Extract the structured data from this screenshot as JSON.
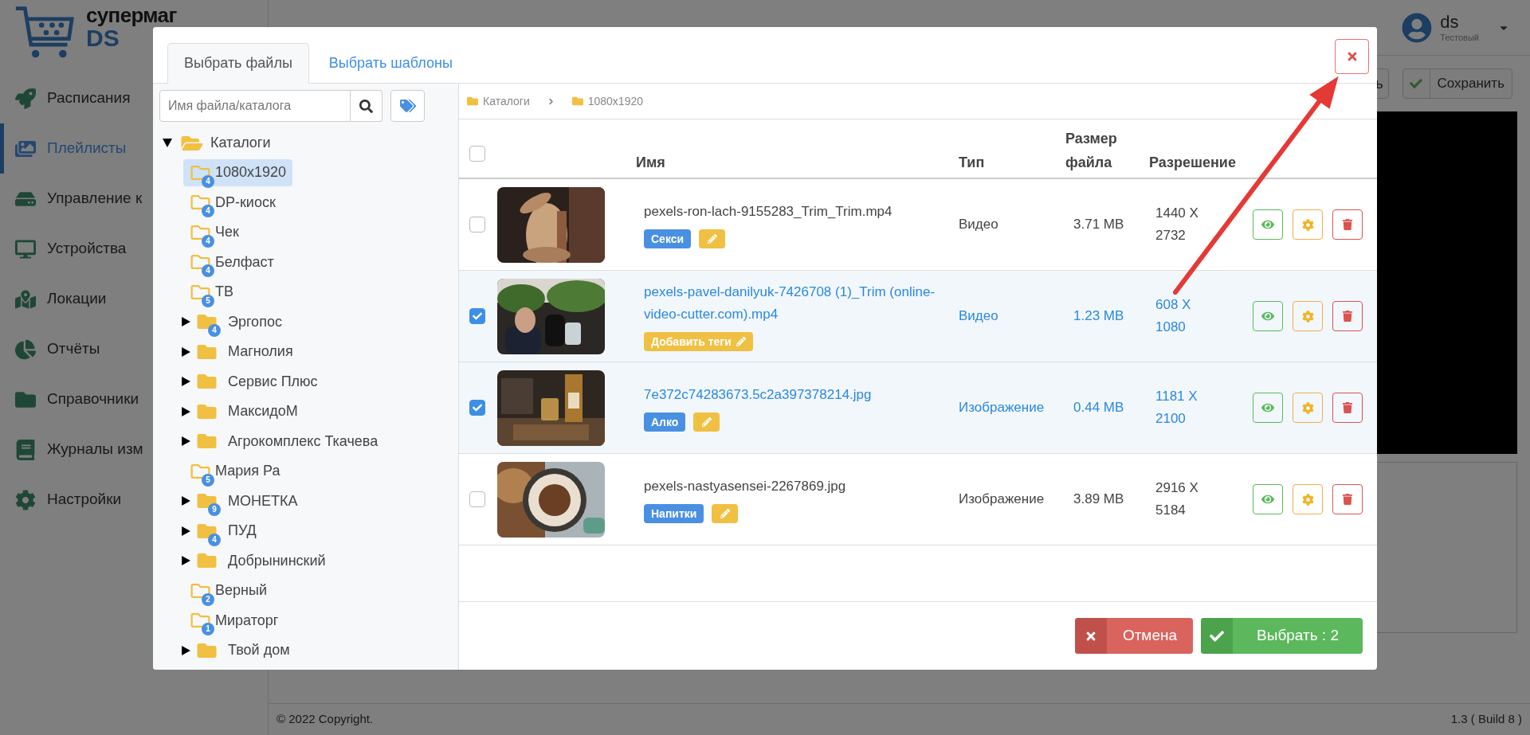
{
  "app": {
    "logo": {
      "line1": "супермаг",
      "line2": "DS"
    },
    "nav": [
      {
        "label": "Расписания",
        "selected": false
      },
      {
        "label": "Плейлисты",
        "selected": true
      },
      {
        "label": "Управление к",
        "selected": false
      },
      {
        "label": "Устройства",
        "selected": false
      },
      {
        "label": "Локации",
        "selected": false
      },
      {
        "label": "Отчёты",
        "selected": false
      },
      {
        "label": "Справочники",
        "selected": false
      },
      {
        "label": "Журналы изм",
        "selected": false
      },
      {
        "label": "Настройки",
        "selected": false
      }
    ],
    "user": {
      "name": "ds",
      "role": "Тестовый"
    },
    "toolbar": [
      {
        "label": "ь"
      },
      {
        "label": "Сохранить"
      }
    ],
    "footer": {
      "copyright": "© 2022 Copyright.",
      "version": "1.3 ( Build 8 )"
    }
  },
  "modal": {
    "tabs": [
      {
        "label": "Выбрать файлы",
        "selected": true
      },
      {
        "label": "Выбрать шаблоны",
        "selected": false
      }
    ],
    "search": {
      "placeholder": "Имя файла/каталога"
    },
    "tree": {
      "label": "Каталоги",
      "expanded": true,
      "children": [
        {
          "kind": "leaf",
          "label": "1080x1920",
          "count": "4",
          "selected": true
        },
        {
          "kind": "leaf",
          "label": "DP-киоск",
          "count": "4",
          "selected": false
        },
        {
          "kind": "leaf",
          "label": "Чек",
          "count": "4",
          "selected": false
        },
        {
          "kind": "leaf",
          "label": "Белфаст",
          "count": "4",
          "selected": false
        },
        {
          "kind": "leaf",
          "label": "ТВ",
          "count": "5",
          "selected": false
        },
        {
          "kind": "branch",
          "label": "Эргопос",
          "count": "4",
          "expanded": false,
          "selected": false
        },
        {
          "kind": "branch",
          "label": "Магнолия",
          "expanded": false,
          "selected": false
        },
        {
          "kind": "branch",
          "label": "Сервис Плюс",
          "expanded": false,
          "selected": false
        },
        {
          "kind": "branch",
          "label": "МаксидоМ",
          "expanded": false,
          "selected": false
        },
        {
          "kind": "branch",
          "label": "Агрокомплекс Ткачева",
          "expanded": false,
          "selected": false
        },
        {
          "kind": "leaf",
          "label": "Мария Ра",
          "count": "5",
          "selected": false
        },
        {
          "kind": "branch",
          "label": "МОНЕТКА",
          "count": "9",
          "expanded": false,
          "selected": false
        },
        {
          "kind": "branch",
          "label": "ПУД",
          "count": "4",
          "expanded": false,
          "selected": false
        },
        {
          "kind": "branch",
          "label": "Добрынинский",
          "expanded": false,
          "selected": false
        },
        {
          "kind": "leaf",
          "label": "Верный",
          "count": "2",
          "selected": false
        },
        {
          "kind": "leaf",
          "label": "Мираторг",
          "count": "1",
          "selected": false
        },
        {
          "kind": "branch",
          "label": "Твой дом",
          "expanded": false,
          "selected": false
        }
      ]
    },
    "breadcrumb": [
      "Каталоги",
      "1080x1920"
    ],
    "select_all": {
      "checked": false
    },
    "columns": [
      "Имя",
      "Тип",
      "Размер файла",
      "Разрешение"
    ],
    "rows": [
      {
        "checked": false,
        "name": "pexels-ron-lach-9155283_Trim_Trim.mp4",
        "tags": [
          {
            "label": "Секси"
          }
        ],
        "type": "Видео",
        "size": "3.71 MB",
        "resolution": "1440 X 2732"
      },
      {
        "checked": true,
        "name": "pexels-pavel-danilyuk-7426708 (1)_Trim (online-video-cutter.com).mp4",
        "tags": [],
        "add_tags": "Добавить теги",
        "type": "Видео",
        "size": "1.23 MB",
        "resolution": "608 X 1080"
      },
      {
        "checked": true,
        "name": "7e372c74283673.5c2a397378214.jpg",
        "tags": [
          {
            "label": "Алко"
          }
        ],
        "type": "Изображение",
        "size": "0.44 MB",
        "resolution": "1181 X 2100"
      },
      {
        "checked": false,
        "name": "pexels-nastyasensei-2267869.jpg",
        "tags": [
          {
            "label": "Напитки"
          }
        ],
        "type": "Изображение",
        "size": "3.89 MB",
        "resolution": "2916 X 5184"
      }
    ],
    "buttons": [
      {
        "kind": "cancel",
        "label": "Отмена"
      },
      {
        "kind": "confirm",
        "label": "Выбрать : 2"
      }
    ]
  }
}
